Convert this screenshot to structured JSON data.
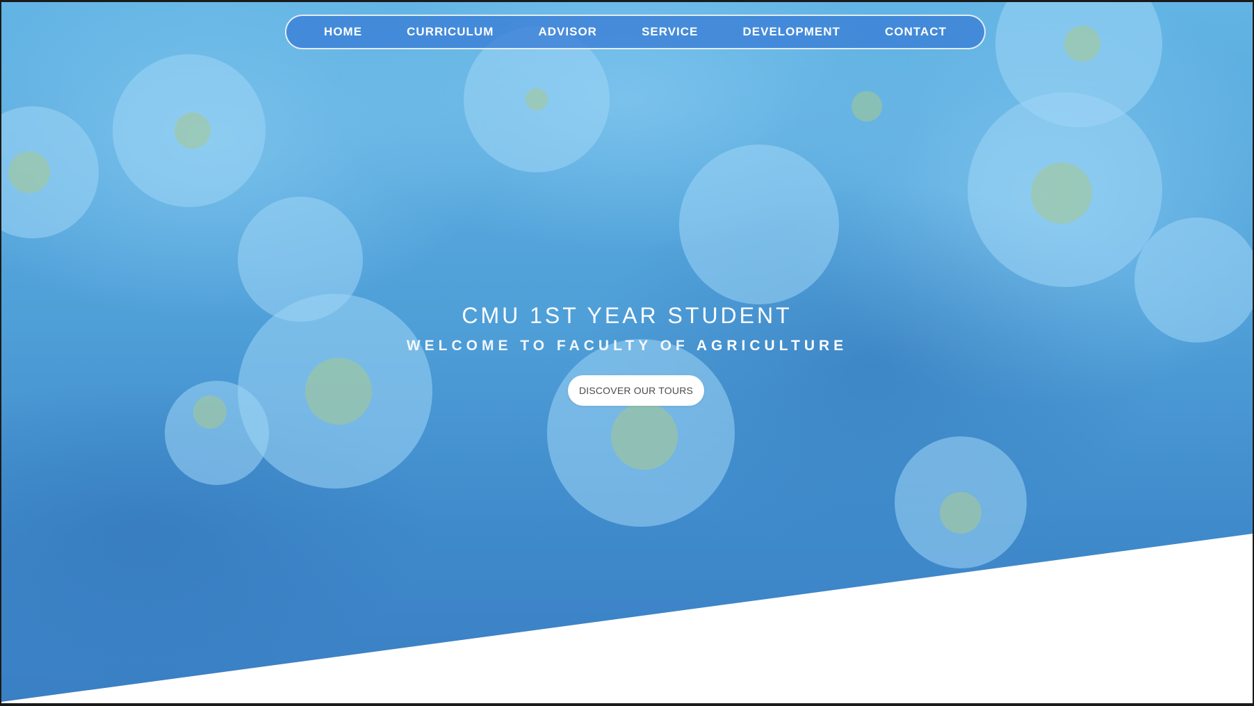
{
  "nav": {
    "items": [
      {
        "label": "HOME"
      },
      {
        "label": "CURRICULUM"
      },
      {
        "label": "ADVISOR"
      },
      {
        "label": "SERVICE"
      },
      {
        "label": "DEVELOPMENT"
      },
      {
        "label": "CONTACT"
      }
    ]
  },
  "hero": {
    "title": "CMU 1ST YEAR STUDENT",
    "subtitle_lead": "WELCOME TO FACULTY OF ",
    "subtitle_strong": "AGRICULTURE",
    "cta_label": "DISCOVER OUR TOURS",
    "background_image": "daisy-flowers-photo"
  },
  "colors": {
    "hero_tint": "#4f9fd8",
    "nav_bg": "#3a7ed6",
    "cta_bg": "#ffffff",
    "cta_text": "#4b4b4b",
    "bottom_bg": "#ffffff"
  }
}
